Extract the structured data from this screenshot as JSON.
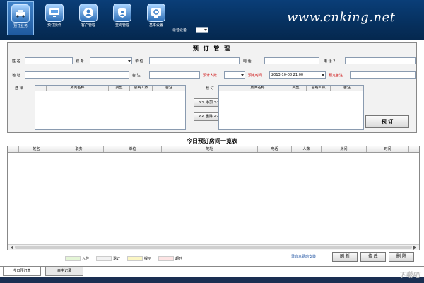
{
  "toolbar": {
    "items": [
      {
        "label": "预订业务"
      },
      {
        "label": "预订操作"
      },
      {
        "label": "客户管理"
      },
      {
        "label": "查询管理"
      },
      {
        "label": "基本设置"
      }
    ],
    "logo": "www.cnking.net",
    "record_device_label": "录音设备"
  },
  "booking": {
    "title": "预 订 管 理",
    "fields": {
      "name_label": "姓 名",
      "title_label": "职 务",
      "company_label": "单 位",
      "phone_label": "电 话",
      "phone2_label": "电 话 2",
      "address_label": "地 址",
      "remark_label": "备 注",
      "people_label": "预计人数",
      "time_label": "预定时间",
      "time_value": "2013-10-08 21:00",
      "note_label": "预定备注"
    },
    "select_label": "选 择",
    "booked_label": "预 订",
    "list_headers": [
      "",
      "房间名称",
      "类型",
      "容纳人数",
      "备注"
    ],
    "add_button": ">> 添加 >>",
    "delete_button": "<< 删除 <<",
    "book_button": "预 订"
  },
  "today_list": {
    "title": "今日预订房间一览表",
    "headers": [
      "",
      "姓名",
      "职务",
      "单位",
      "地址",
      "电话",
      "人数",
      "房间",
      "时间",
      ""
    ]
  },
  "legend": [
    {
      "label": "入住",
      "color": "#e4f5d6"
    },
    {
      "label": "退订",
      "color": "#f2f2f2"
    },
    {
      "label": "提示",
      "color": "#fbf6c4"
    },
    {
      "label": "超时",
      "color": "#fde4e4"
    }
  ],
  "hint": "录音盒驱动安装",
  "actions": {
    "refresh": "刷 新",
    "edit": "修 改",
    "delete": "删 除"
  },
  "tabs": [
    {
      "label": "今日预订表"
    },
    {
      "label": "来电记录"
    }
  ],
  "watermark": "下载吧"
}
